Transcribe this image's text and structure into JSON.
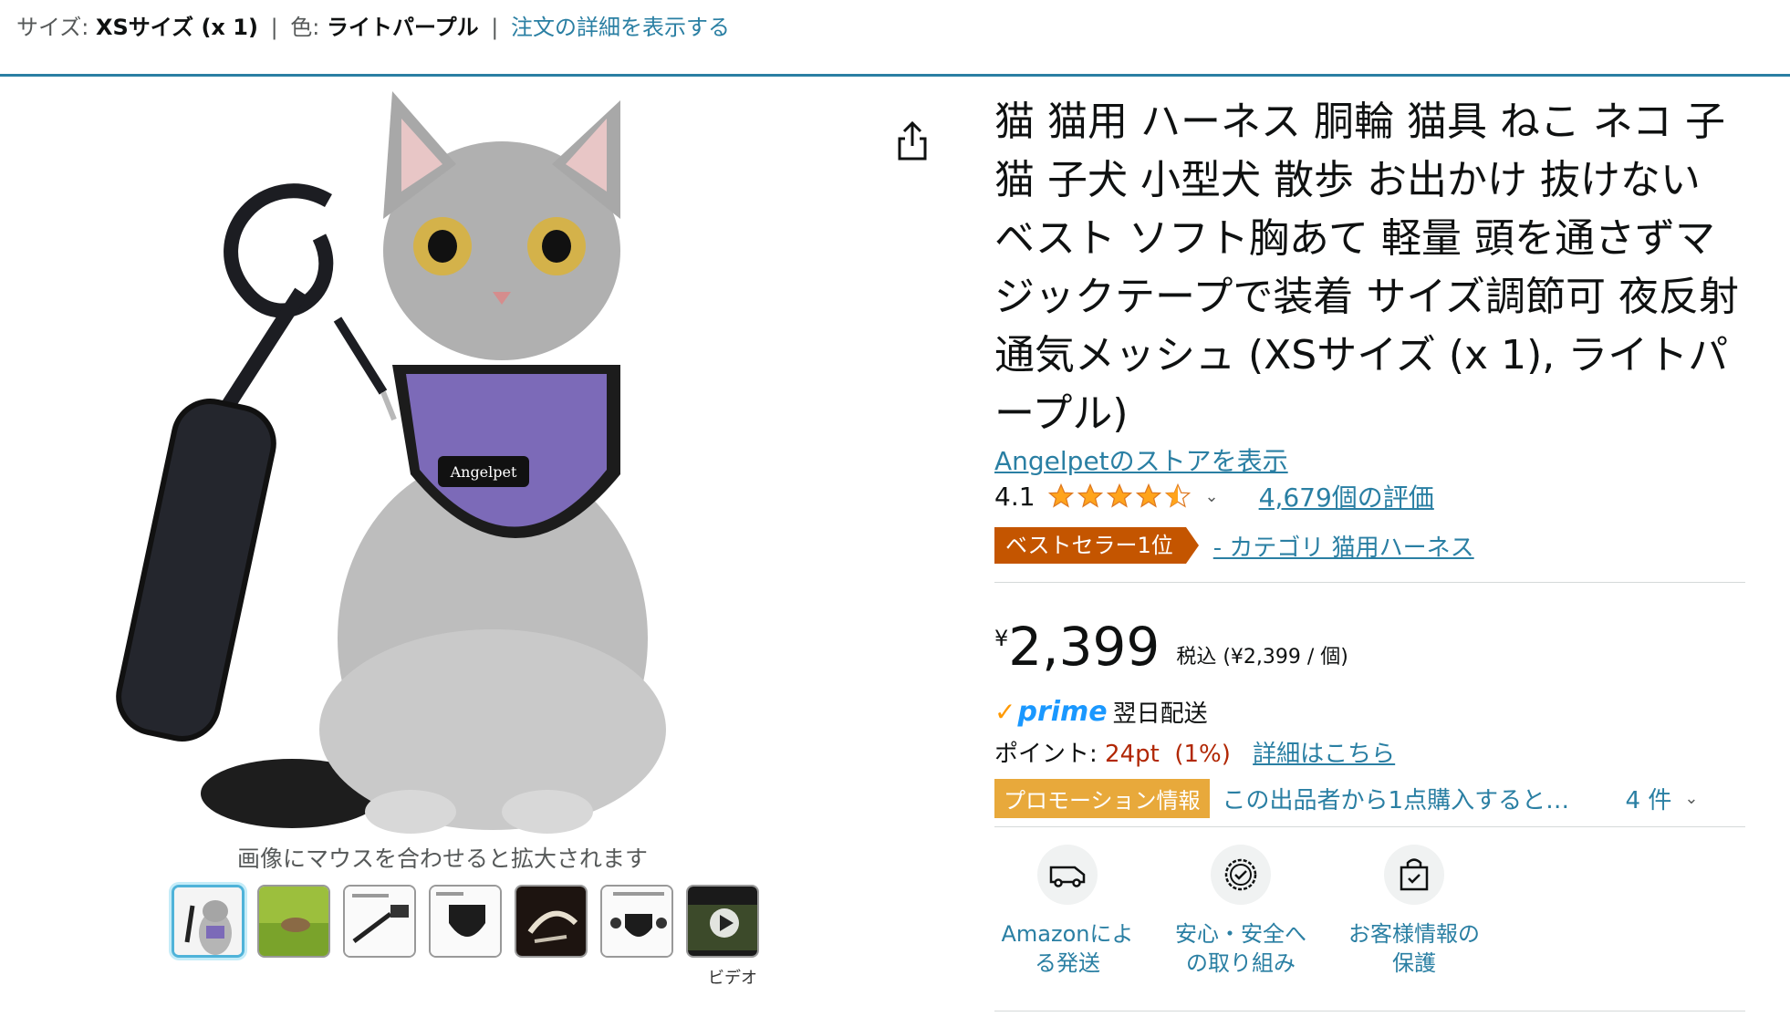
{
  "breadcrumb": {
    "size_label": "サイズ:",
    "size_value": "XSサイズ (x 1)",
    "color_label": "色:",
    "color_value": "ライトパープル",
    "details_link": "注文の詳細を表示する"
  },
  "gallery": {
    "zoom_hint": "画像にマウスを合わせると拡大されます",
    "video_label": "ビデオ"
  },
  "product": {
    "title": "猫 猫用 ハーネス 胴輪 猫具 ねこ ネコ 子猫 子犬 小型犬 散歩 お出かけ 抜けない ベスト ソフト胸あて 軽量 頭を通さずマジックテープで装着 サイズ調節可 夜反射 通気メッシュ (XSサイズ (x 1), ライトパープル)",
    "store_link": "Angelpetのストアを表示",
    "rating": "4.1",
    "rating_count": "4,679個の評価",
    "bestseller_badge": "ベストセラー1位",
    "bestseller_category": "- カテゴリ 猫用ハーネス"
  },
  "price": {
    "currency": "¥",
    "amount": "2,399",
    "tax_note": "税込 (¥2,399 / 個)"
  },
  "prime": {
    "logo": "prime",
    "delivery": "翌日配送"
  },
  "points": {
    "label": "ポイント:",
    "value": "24pt  (1%)",
    "link": "詳細はこちら"
  },
  "promotion": {
    "badge": "プロモーション情報",
    "text": "この出品者から1点購入すると…",
    "count": "4 件"
  },
  "features": [
    {
      "label": "Amazonによる発送",
      "icon": "delivery-van-icon"
    },
    {
      "label": "安心・安全への取り組み",
      "icon": "badge-check-icon"
    },
    {
      "label": "お客様情報の保護",
      "icon": "secure-bag-icon"
    }
  ],
  "colors": {
    "link": "#2a7fa3",
    "bestseller": "#c45500",
    "promo": "#e8a93b",
    "star": "#ffa41c",
    "points": "#b12704"
  }
}
